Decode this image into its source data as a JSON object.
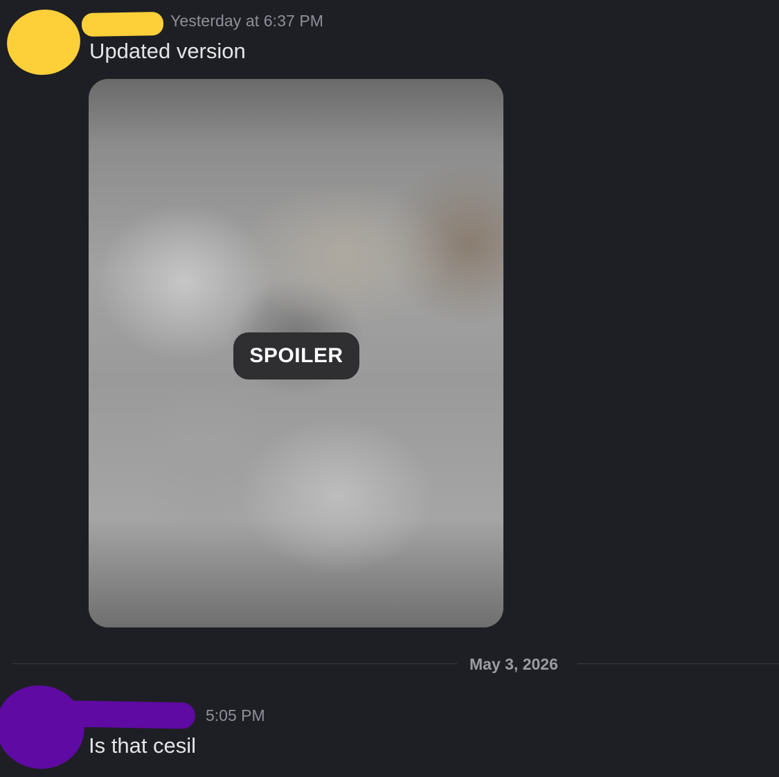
{
  "messages": [
    {
      "timestamp": "Yesterday at 6:37 PM",
      "text": "Updated version",
      "attachment": {
        "spoiler_label": "SPOILER"
      }
    },
    {
      "timestamp": "5:05 PM",
      "text": "Is that cesil"
    }
  ],
  "divider": {
    "date": "May 3, 2026"
  },
  "colors": {
    "background": "#1e1f24",
    "redaction_user_1": "#fdd03a",
    "redaction_user_2": "#5f0aa3",
    "message_text": "#e4e5e8",
    "timestamp_text": "#8e9099"
  }
}
